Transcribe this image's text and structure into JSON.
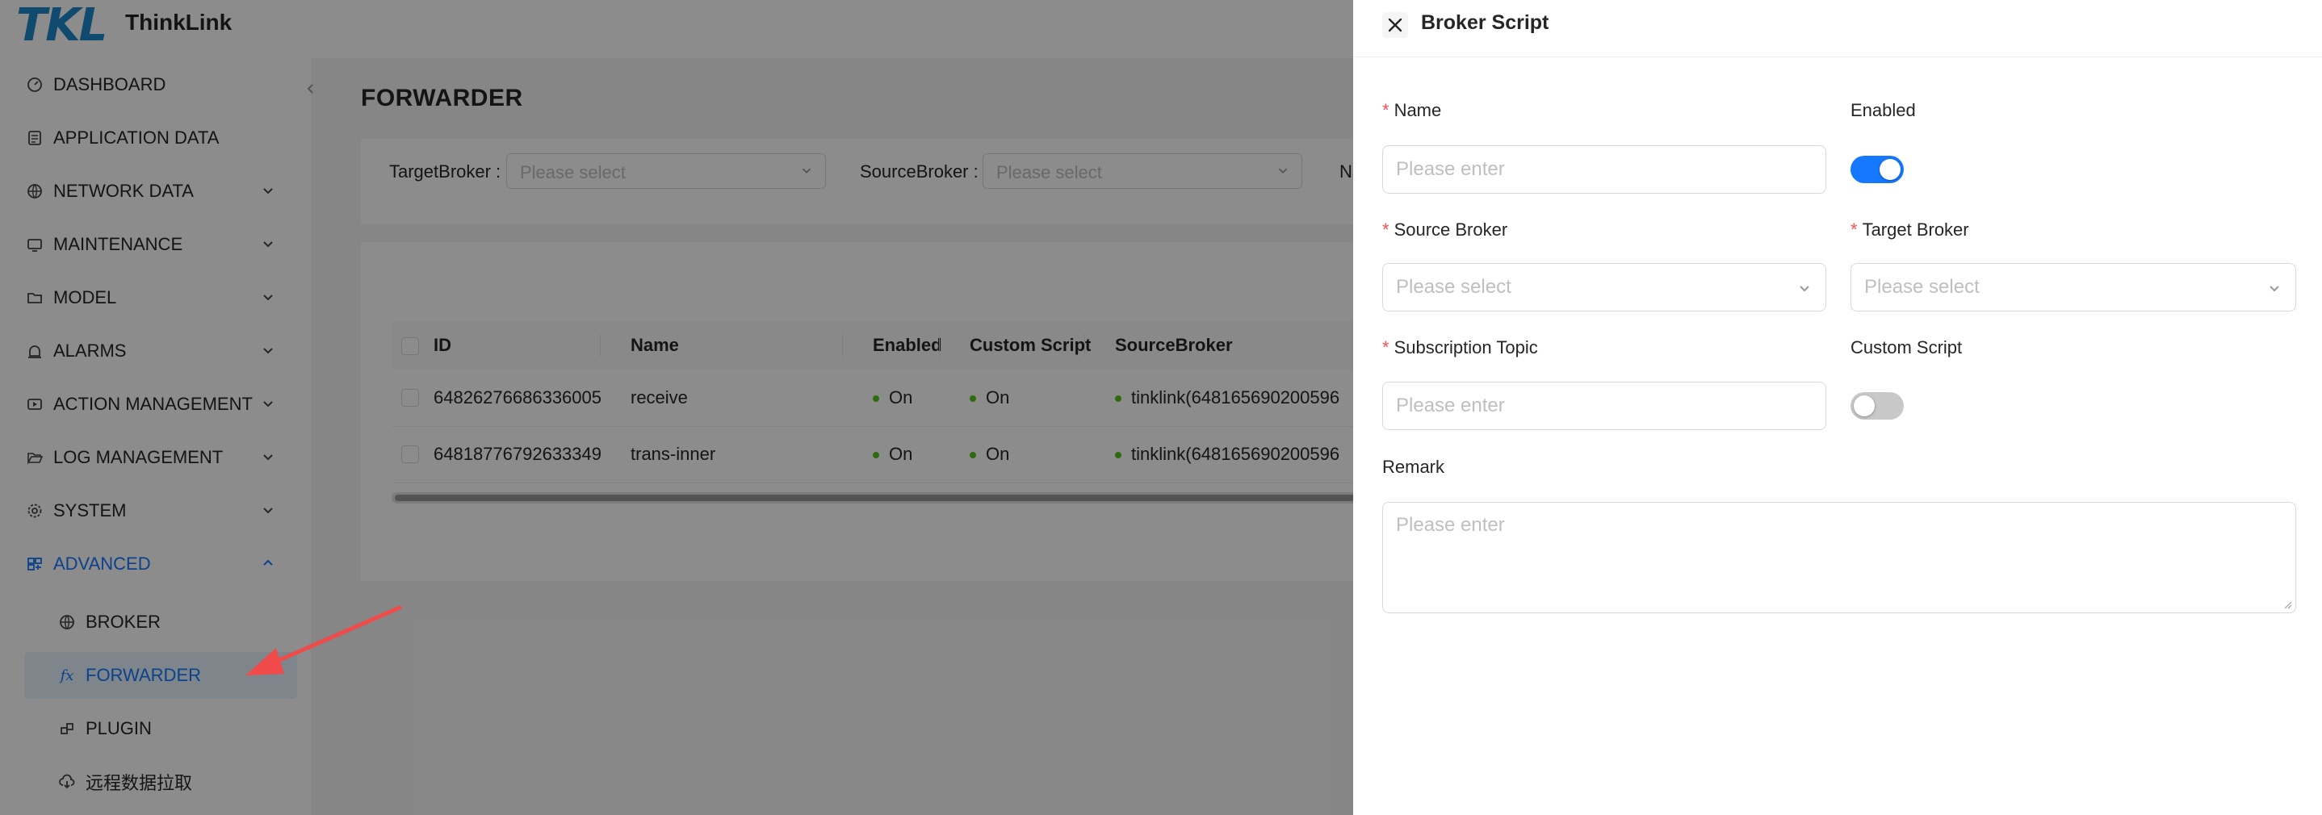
{
  "app": {
    "logo_mark": "TKL",
    "name": "ThinkLink"
  },
  "sidebar": {
    "items": [
      {
        "label": "DASHBOARD",
        "icon": "dashboard-icon"
      },
      {
        "label": "APPLICATION DATA",
        "icon": "document-icon"
      },
      {
        "label": "NETWORK DATA",
        "icon": "globe-icon"
      },
      {
        "label": "MAINTENANCE",
        "icon": "monitor-icon"
      },
      {
        "label": "MODEL",
        "icon": "folder-icon"
      },
      {
        "label": "ALARMS",
        "icon": "alarm-icon"
      },
      {
        "label": "ACTION MANAGEMENT",
        "icon": "action-icon"
      },
      {
        "label": "LOG MANAGEMENT",
        "icon": "folder-open-icon"
      },
      {
        "label": "SYSTEM",
        "icon": "gear-icon"
      },
      {
        "label": "ADVANCED",
        "icon": "advanced-icon"
      }
    ],
    "submenu": [
      {
        "label": "BROKER",
        "icon": "globe-icon"
      },
      {
        "label": "FORWARDER",
        "icon": "fx-icon"
      },
      {
        "label": "PLUGIN",
        "icon": "plugin-icon"
      },
      {
        "label": "远程数据拉取",
        "icon": "cloud-download-icon"
      }
    ],
    "fx_glyph": "fx"
  },
  "page": {
    "title": "FORWARDER",
    "filters": [
      {
        "label": "TargetBroker :",
        "placeholder": "Please select"
      },
      {
        "label": "SourceBroker :",
        "placeholder": "Please select"
      },
      {
        "label": "Na"
      }
    ]
  },
  "table": {
    "columns": [
      "ID",
      "Name",
      "Enabled",
      "Custom Script",
      "SourceBroker"
    ],
    "rows": [
      {
        "id": "64826276686336005",
        "name": "receive",
        "enabled": "On",
        "custom_script": "On",
        "source_broker": "tinklink(648165690200596"
      },
      {
        "id": "64818776792633349",
        "name": "trans-inner",
        "enabled": "On",
        "custom_script": "On",
        "source_broker": "tinklink(648165690200596"
      }
    ]
  },
  "drawer": {
    "title": "Broker Script",
    "fields": {
      "name": {
        "label": "Name",
        "placeholder": "Please enter"
      },
      "enabled": {
        "label": "Enabled",
        "value": true
      },
      "source_broker": {
        "label": "Source Broker",
        "placeholder": "Please select"
      },
      "target_broker": {
        "label": "Target Broker",
        "placeholder": "Please select"
      },
      "subscription_topic": {
        "label": "Subscription Topic",
        "placeholder": "Please enter"
      },
      "custom_script": {
        "label": "Custom Script",
        "value": false
      },
      "remark": {
        "label": "Remark",
        "placeholder": "Please enter"
      }
    },
    "required_mark": "*"
  },
  "colors": {
    "primary": "#1677ff",
    "required": "#ff4d4f",
    "status_on": "#52c41a",
    "annotation_arrow": "#f04a4a"
  }
}
